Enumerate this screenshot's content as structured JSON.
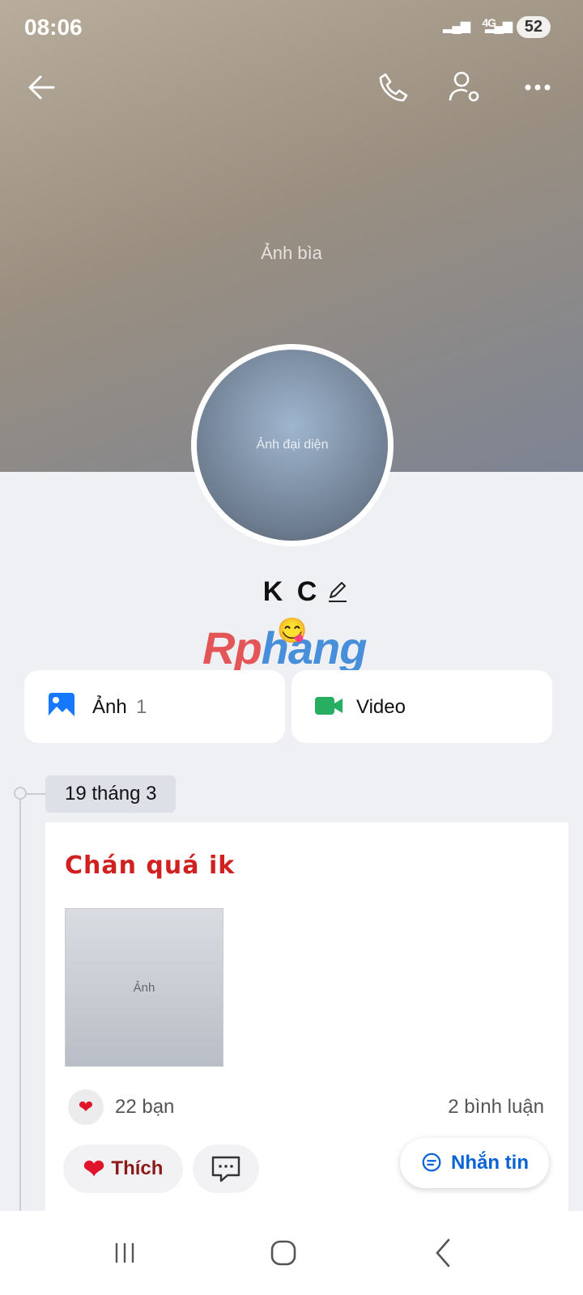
{
  "status": {
    "time": "08:06",
    "network": "4G",
    "battery": "52"
  },
  "cover": {
    "placeholder": "Ảnh bìa"
  },
  "avatar": {
    "placeholder": "Ảnh đại diện"
  },
  "profile": {
    "name": "K C",
    "emoji": "😋"
  },
  "watermark": {
    "part1": "Rp",
    "part2": "hang"
  },
  "chips": [
    {
      "label": "Ảnh",
      "count": "1"
    },
    {
      "label": "Video"
    }
  ],
  "timeline": {
    "date": "19 tháng 3",
    "post": {
      "title": "Chán quá ik",
      "image_placeholder": "Ảnh",
      "likes": "22 bạn",
      "comments": "2 bình luận",
      "like_label": "Thích"
    }
  },
  "message_button": "Nhắn tin",
  "colors": {
    "accent": "#0a63d6",
    "like": "#e0142b",
    "title": "#d02020",
    "video": "#27ae60"
  }
}
